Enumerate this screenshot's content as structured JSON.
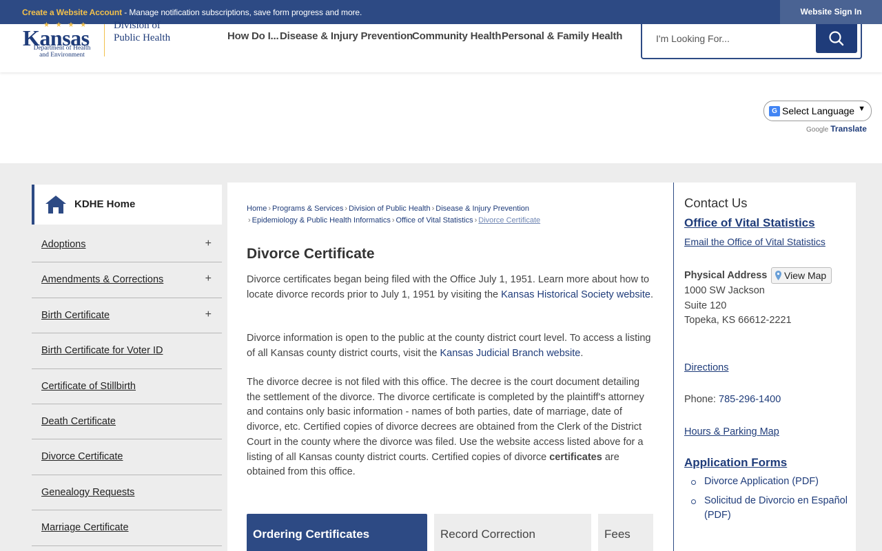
{
  "topbar": {
    "create_account": "Create a Website Account",
    "message": " - Manage notification subscriptions, save form progress and more.",
    "sign_in": "Website Sign In"
  },
  "logo": {
    "kansas": "Kansas",
    "dept_line1": "Department of Health",
    "dept_line2": "and Environment",
    "division_line1": "Division of",
    "division_line2": "Public Health"
  },
  "nav": [
    "How Do I...",
    "Disease & Injury Prevention",
    "Community Health",
    "Personal & Family Health"
  ],
  "search": {
    "placeholder": "I'm Looking For..."
  },
  "translate": {
    "select_label": "Select Language",
    "powered_by": "Google",
    "translate_link": "Translate"
  },
  "sidebar": {
    "home": "KDHE Home",
    "items": [
      {
        "label": "Adoptions",
        "expand": "+"
      },
      {
        "label": "Amendments & Corrections",
        "expand": "+"
      },
      {
        "label": "Birth Certificate",
        "expand": "+"
      },
      {
        "label": "Birth Certificate for Voter ID",
        "expand": ""
      },
      {
        "label": "Certificate of Stillbirth",
        "expand": ""
      },
      {
        "label": "Death Certificate",
        "expand": ""
      },
      {
        "label": "Divorce Certificate",
        "expand": ""
      },
      {
        "label": "Genealogy Requests",
        "expand": ""
      },
      {
        "label": "Marriage Certificate",
        "expand": ""
      }
    ]
  },
  "breadcrumb": {
    "items": [
      "Home",
      "Programs & Services",
      "Division of Public Health",
      "Disease & Injury Prevention",
      "Epidemiology & Public Health Informatics",
      "Office of Vital Statistics"
    ],
    "current": "Divorce Certificate"
  },
  "main": {
    "title": "Divorce Certificate",
    "p1_text": "Divorce certificates began being filed with the Office July 1, 1951. Learn more about how to locate divorce records prior to July 1, 1951 by visiting the ",
    "p1_link": "Kansas Historical Society website",
    "p1_end": ".",
    "p2_text": "Divorce information is open to the public at the county district court level. To access a listing of all Kansas county district courts, visit the ",
    "p2_link": "Kansas Judicial Branch website",
    "p2_end": ".",
    "p3_text": "The divorce decree is not filed with this office. The decree is the court document detailing the settlement of the divorce. The divorce certificate is completed by the plaintiff's attorney and contains only basic information - names of both parties, date of marriage, date of divorce, etc. Certified copies of divorce decrees are obtained from the Clerk of the District Court in the county where the divorce was filed. Use the website access listed above for a listing of all Kansas county district courts. Certified copies of divorce ",
    "p3_bold": "certificates",
    "p3_end": " are obtained from this office.",
    "tabs": [
      "Ordering Certificates",
      "Record Correction",
      "Fees"
    ]
  },
  "contact": {
    "heading": "Contact Us",
    "office": "Office of Vital Statistics",
    "email": "Email the Office of Vital Statistics",
    "address_label": "Physical Address",
    "view_map": "View Map",
    "address_line1": "1000 SW Jackson",
    "address_line2": "Suite 120",
    "address_line3": "Topeka, KS 66612-2221",
    "directions": "Directions",
    "phone_label": "Phone: ",
    "phone": "785-296-1400",
    "hours": "Hours & Parking Map",
    "forms_heading": "Application Forms",
    "forms": [
      "Divorce Application (PDF)",
      "Solicitud de Divorcio en Español (PDF)"
    ]
  },
  "colors": {
    "brand_blue": "#2d4a84",
    "accent_gold": "#f2c04b",
    "band_gray": "#ededed"
  }
}
